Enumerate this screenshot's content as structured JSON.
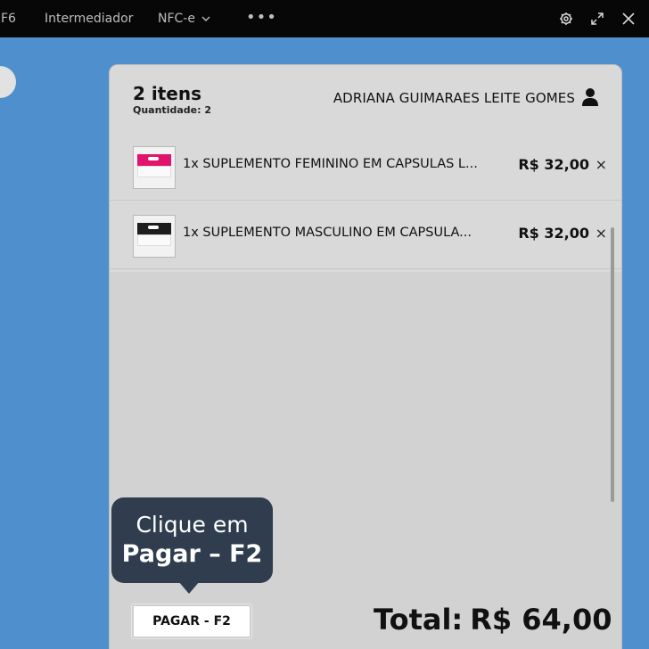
{
  "topbar": {
    "items": [
      "F6",
      "Intermediador",
      "NFC-e",
      "•••"
    ],
    "icons": [
      "gear-icon",
      "expand-icon",
      "close-icon"
    ]
  },
  "cart": {
    "count_label": "2 itens",
    "quantity_label": "Quantidade: 2",
    "customer_name": "ADRIANA GUIMARAES LEITE GOMES",
    "items": [
      {
        "name": "1x SUPLEMENTO FEMININO EM CAPSULAS L...",
        "price": "R$ 32,00",
        "remove": "×",
        "thumb_color": "#e0146b"
      },
      {
        "name": "1x SUPLEMENTO MASCULINO EM CAPSULA...",
        "price": "R$ 32,00",
        "remove": "×",
        "thumb_color": "#1e1e1e"
      }
    ]
  },
  "tooltip": {
    "line1": "Clique em",
    "line2": "Pagar – F2"
  },
  "pay_button": {
    "label": "PAGAR - F2"
  },
  "total": {
    "label": "Total:",
    "amount": "R$ 64,00"
  },
  "colors": {
    "background": "#4f8fcd",
    "topbar": "#070707",
    "panel": "#d2d2d2",
    "tooltip": "#2f3d4e"
  }
}
